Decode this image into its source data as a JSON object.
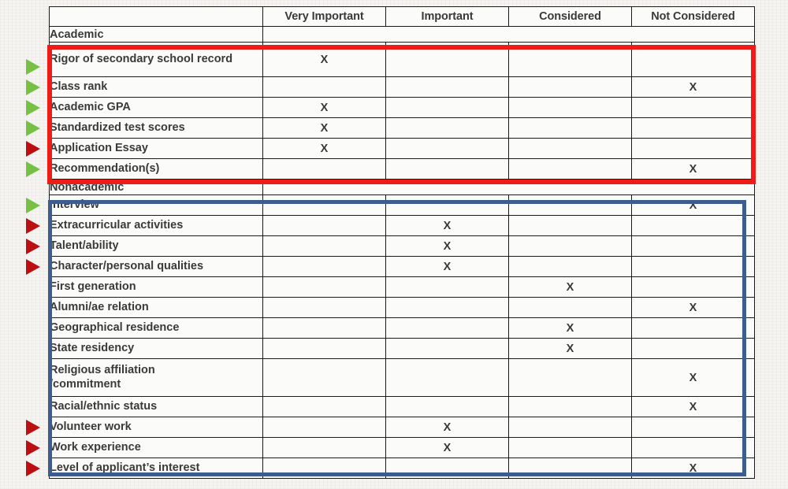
{
  "table": {
    "columns": [
      "",
      "Very Important",
      "Important",
      "Considered",
      "Not Considered"
    ],
    "sections": [
      {
        "name": "Academic",
        "highlight_color": "#ec1c18",
        "rows": [
          {
            "label": "Rigor of secondary school record",
            "very_important": "X",
            "important": "",
            "considered": "",
            "not_considered": "",
            "marker": "green"
          },
          {
            "label": "Class rank",
            "very_important": "",
            "important": "",
            "considered": "",
            "not_considered": "X",
            "marker": "green"
          },
          {
            "label": "Academic GPA",
            "very_important": "X",
            "important": "",
            "considered": "",
            "not_considered": "",
            "marker": "green"
          },
          {
            "label": "Standardized test scores",
            "very_important": "X",
            "important": "",
            "considered": "",
            "not_considered": "",
            "marker": "green"
          },
          {
            "label": "Application Essay",
            "very_important": "X",
            "important": "",
            "considered": "",
            "not_considered": "",
            "marker": "red"
          },
          {
            "label": "Recommendation(s)",
            "very_important": "",
            "important": "",
            "considered": "",
            "not_considered": "X",
            "marker": "green"
          }
        ]
      },
      {
        "name": "Nonacademic",
        "highlight_color": "#3d5d8e",
        "rows": [
          {
            "label": "Interview",
            "very_important": "",
            "important": "",
            "considered": "",
            "not_considered": "X",
            "marker": "green"
          },
          {
            "label": "Extracurricular activities",
            "very_important": "",
            "important": "X",
            "considered": "",
            "not_considered": "",
            "marker": "red"
          },
          {
            "label": "Talent/ability",
            "very_important": "",
            "important": "X",
            "considered": "",
            "not_considered": "",
            "marker": "red"
          },
          {
            "label": "Character/personal qualities",
            "very_important": "",
            "important": "X",
            "considered": "",
            "not_considered": "",
            "marker": "red"
          },
          {
            "label": "First generation",
            "very_important": "",
            "important": "",
            "considered": "X",
            "not_considered": "",
            "marker": "none"
          },
          {
            "label": "Alumni/ae relation",
            "very_important": "",
            "important": "",
            "considered": "",
            "not_considered": "X",
            "marker": "none"
          },
          {
            "label": "Geographical residence",
            "very_important": "",
            "important": "",
            "considered": "X",
            "not_considered": "",
            "marker": "none"
          },
          {
            "label": "State residency",
            "very_important": "",
            "important": "",
            "considered": "X",
            "not_considered": "",
            "marker": "none"
          },
          {
            "label": "Religious affiliation\n/commitment",
            "very_important": "",
            "important": "",
            "considered": "",
            "not_considered": "X",
            "marker": "none"
          },
          {
            "label": "Racial/ethnic status",
            "very_important": "",
            "important": "",
            "considered": "",
            "not_considered": "X",
            "marker": "none"
          },
          {
            "label": "Volunteer work",
            "very_important": "",
            "important": "X",
            "considered": "",
            "not_considered": "",
            "marker": "red"
          },
          {
            "label": "Work experience",
            "very_important": "",
            "important": "X",
            "considered": "",
            "not_considered": "",
            "marker": "red"
          },
          {
            "label": "Level of applicant’s interest",
            "very_important": "",
            "important": "",
            "considered": "",
            "not_considered": "X",
            "marker": "red"
          }
        ]
      }
    ]
  },
  "markers": {
    "green_color": "#76c044",
    "red_color": "#bc0f12",
    "green_name": "green-arrow-marker",
    "red_name": "red-arrow-marker"
  }
}
